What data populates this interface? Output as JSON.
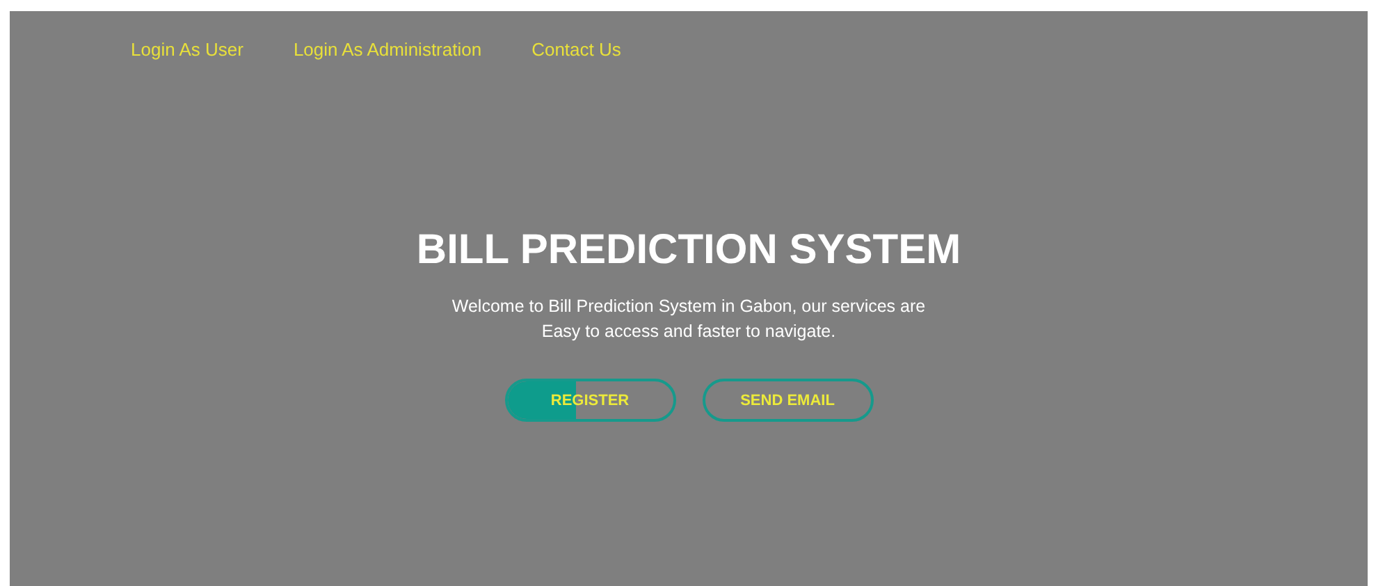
{
  "nav": [
    {
      "label": "Login As User"
    },
    {
      "label": "Login As Administration"
    },
    {
      "label": "Contact Us"
    }
  ],
  "hero": {
    "title": "BILL PREDICTION SYSTEM",
    "text": "Welcome to Bill Prediction System in Gabon, our services are Easy to access and faster to navigate.",
    "buttons": [
      {
        "label": "REGISTER",
        "level": 0.42
      },
      {
        "label": "SEND EMAIL"
      }
    ]
  }
}
